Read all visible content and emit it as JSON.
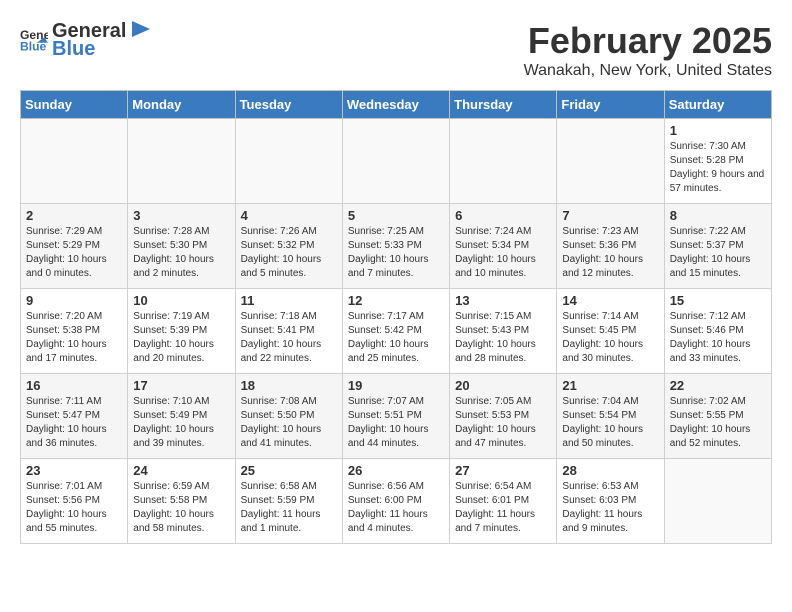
{
  "logo": {
    "general": "General",
    "blue": "Blue"
  },
  "title": "February 2025",
  "subtitle": "Wanakah, New York, United States",
  "days_of_week": [
    "Sunday",
    "Monday",
    "Tuesday",
    "Wednesday",
    "Thursday",
    "Friday",
    "Saturday"
  ],
  "weeks": [
    [
      {
        "day": "",
        "info": ""
      },
      {
        "day": "",
        "info": ""
      },
      {
        "day": "",
        "info": ""
      },
      {
        "day": "",
        "info": ""
      },
      {
        "day": "",
        "info": ""
      },
      {
        "day": "",
        "info": ""
      },
      {
        "day": "1",
        "info": "Sunrise: 7:30 AM\nSunset: 5:28 PM\nDaylight: 9 hours and 57 minutes."
      }
    ],
    [
      {
        "day": "2",
        "info": "Sunrise: 7:29 AM\nSunset: 5:29 PM\nDaylight: 10 hours and 0 minutes."
      },
      {
        "day": "3",
        "info": "Sunrise: 7:28 AM\nSunset: 5:30 PM\nDaylight: 10 hours and 2 minutes."
      },
      {
        "day": "4",
        "info": "Sunrise: 7:26 AM\nSunset: 5:32 PM\nDaylight: 10 hours and 5 minutes."
      },
      {
        "day": "5",
        "info": "Sunrise: 7:25 AM\nSunset: 5:33 PM\nDaylight: 10 hours and 7 minutes."
      },
      {
        "day": "6",
        "info": "Sunrise: 7:24 AM\nSunset: 5:34 PM\nDaylight: 10 hours and 10 minutes."
      },
      {
        "day": "7",
        "info": "Sunrise: 7:23 AM\nSunset: 5:36 PM\nDaylight: 10 hours and 12 minutes."
      },
      {
        "day": "8",
        "info": "Sunrise: 7:22 AM\nSunset: 5:37 PM\nDaylight: 10 hours and 15 minutes."
      }
    ],
    [
      {
        "day": "9",
        "info": "Sunrise: 7:20 AM\nSunset: 5:38 PM\nDaylight: 10 hours and 17 minutes."
      },
      {
        "day": "10",
        "info": "Sunrise: 7:19 AM\nSunset: 5:39 PM\nDaylight: 10 hours and 20 minutes."
      },
      {
        "day": "11",
        "info": "Sunrise: 7:18 AM\nSunset: 5:41 PM\nDaylight: 10 hours and 22 minutes."
      },
      {
        "day": "12",
        "info": "Sunrise: 7:17 AM\nSunset: 5:42 PM\nDaylight: 10 hours and 25 minutes."
      },
      {
        "day": "13",
        "info": "Sunrise: 7:15 AM\nSunset: 5:43 PM\nDaylight: 10 hours and 28 minutes."
      },
      {
        "day": "14",
        "info": "Sunrise: 7:14 AM\nSunset: 5:45 PM\nDaylight: 10 hours and 30 minutes."
      },
      {
        "day": "15",
        "info": "Sunrise: 7:12 AM\nSunset: 5:46 PM\nDaylight: 10 hours and 33 minutes."
      }
    ],
    [
      {
        "day": "16",
        "info": "Sunrise: 7:11 AM\nSunset: 5:47 PM\nDaylight: 10 hours and 36 minutes."
      },
      {
        "day": "17",
        "info": "Sunrise: 7:10 AM\nSunset: 5:49 PM\nDaylight: 10 hours and 39 minutes."
      },
      {
        "day": "18",
        "info": "Sunrise: 7:08 AM\nSunset: 5:50 PM\nDaylight: 10 hours and 41 minutes."
      },
      {
        "day": "19",
        "info": "Sunrise: 7:07 AM\nSunset: 5:51 PM\nDaylight: 10 hours and 44 minutes."
      },
      {
        "day": "20",
        "info": "Sunrise: 7:05 AM\nSunset: 5:53 PM\nDaylight: 10 hours and 47 minutes."
      },
      {
        "day": "21",
        "info": "Sunrise: 7:04 AM\nSunset: 5:54 PM\nDaylight: 10 hours and 50 minutes."
      },
      {
        "day": "22",
        "info": "Sunrise: 7:02 AM\nSunset: 5:55 PM\nDaylight: 10 hours and 52 minutes."
      }
    ],
    [
      {
        "day": "23",
        "info": "Sunrise: 7:01 AM\nSunset: 5:56 PM\nDaylight: 10 hours and 55 minutes."
      },
      {
        "day": "24",
        "info": "Sunrise: 6:59 AM\nSunset: 5:58 PM\nDaylight: 10 hours and 58 minutes."
      },
      {
        "day": "25",
        "info": "Sunrise: 6:58 AM\nSunset: 5:59 PM\nDaylight: 11 hours and 1 minute."
      },
      {
        "day": "26",
        "info": "Sunrise: 6:56 AM\nSunset: 6:00 PM\nDaylight: 11 hours and 4 minutes."
      },
      {
        "day": "27",
        "info": "Sunrise: 6:54 AM\nSunset: 6:01 PM\nDaylight: 11 hours and 7 minutes."
      },
      {
        "day": "28",
        "info": "Sunrise: 6:53 AM\nSunset: 6:03 PM\nDaylight: 11 hours and 9 minutes."
      },
      {
        "day": "",
        "info": ""
      }
    ]
  ]
}
